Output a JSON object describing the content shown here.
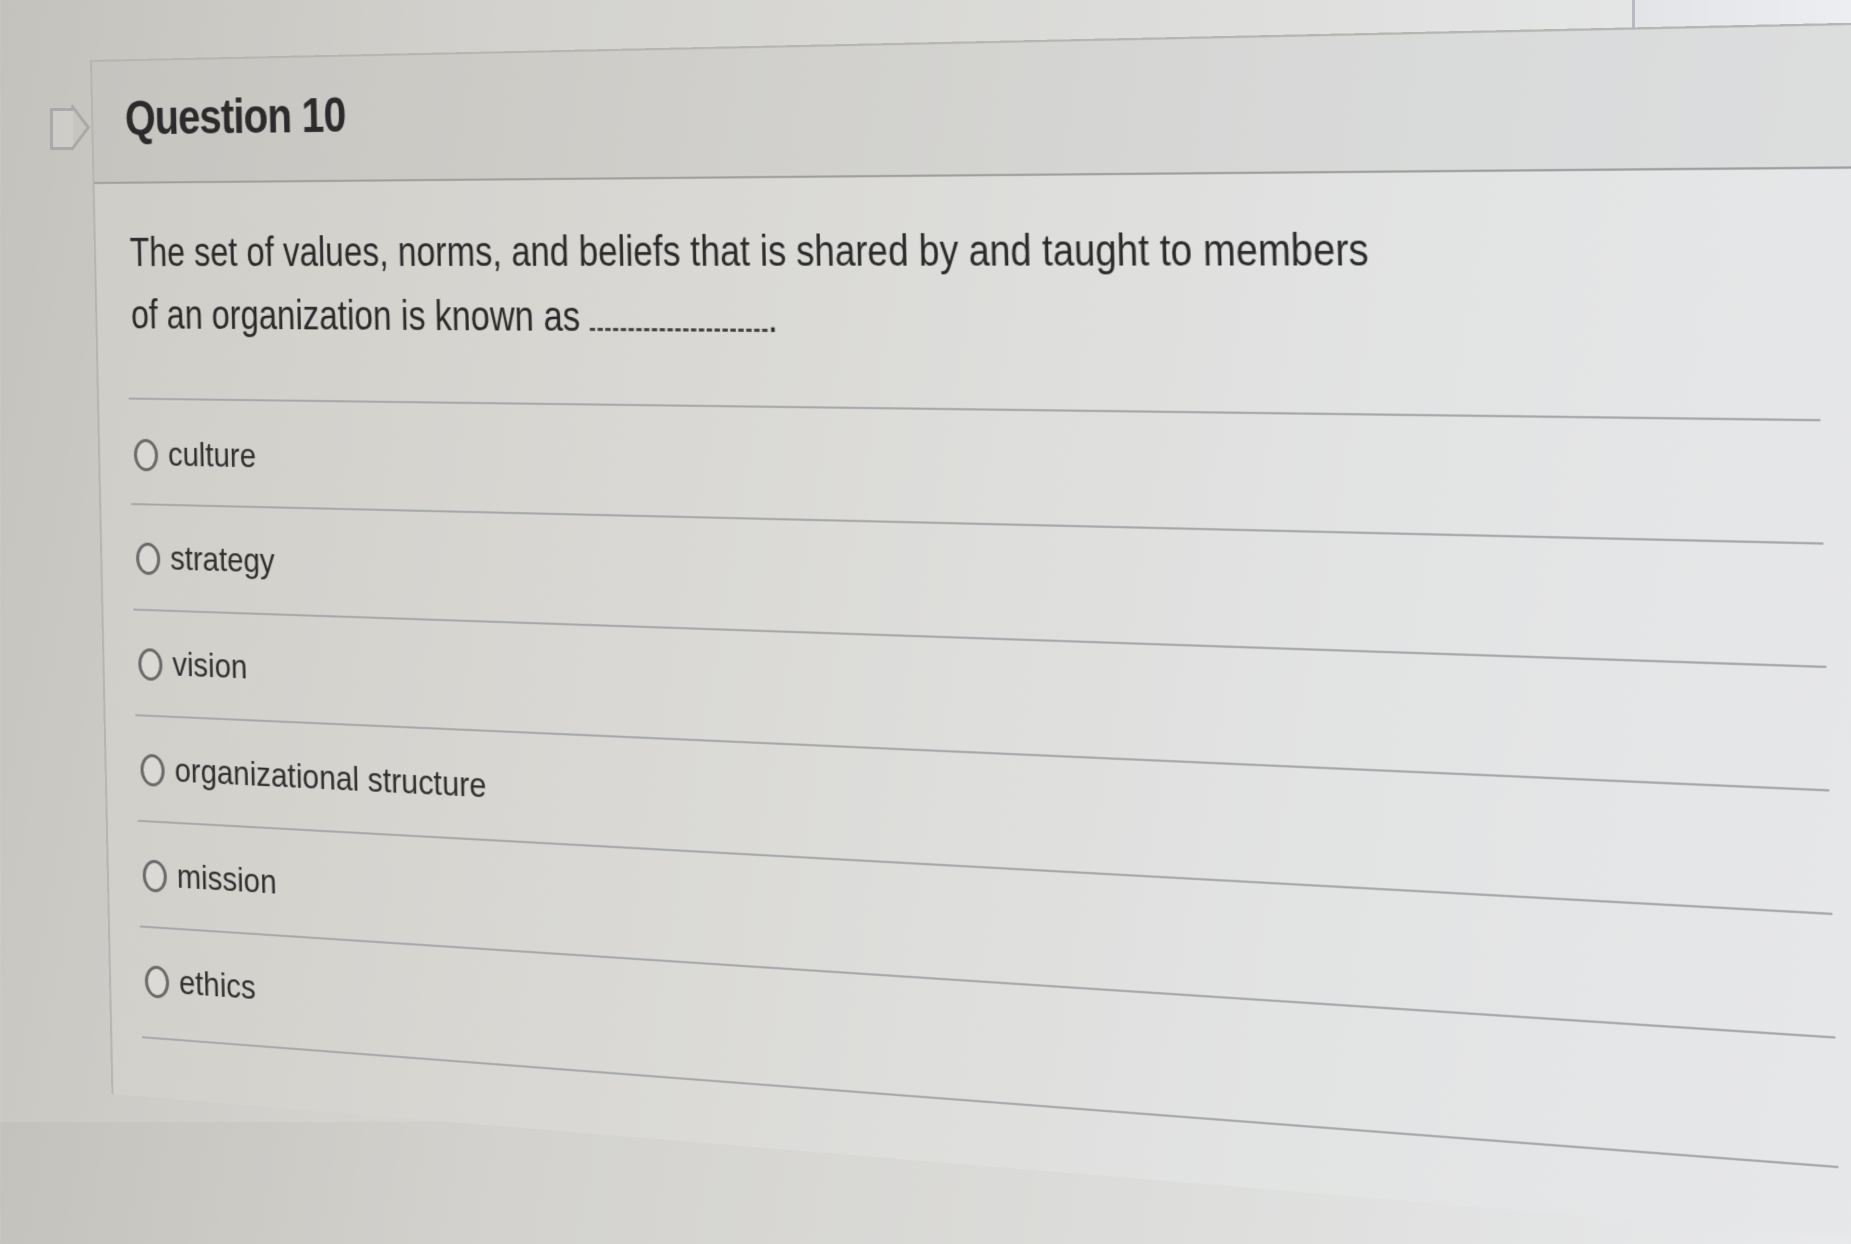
{
  "question": {
    "title": "Question 10",
    "text": "The set of values, norms, and beliefs that is shared by and taught to members of an organization is known as",
    "blank_suffix": "."
  },
  "options": [
    {
      "label": "culture",
      "selected": false
    },
    {
      "label": "strategy",
      "selected": false
    },
    {
      "label": "vision",
      "selected": false
    },
    {
      "label": "organizational structure",
      "selected": false
    },
    {
      "label": "mission",
      "selected": false
    },
    {
      "label": "ethics",
      "selected": false
    }
  ],
  "icons": {
    "bookmark": "bookmark-flag-icon",
    "radio": "radio-unselected-icon"
  }
}
